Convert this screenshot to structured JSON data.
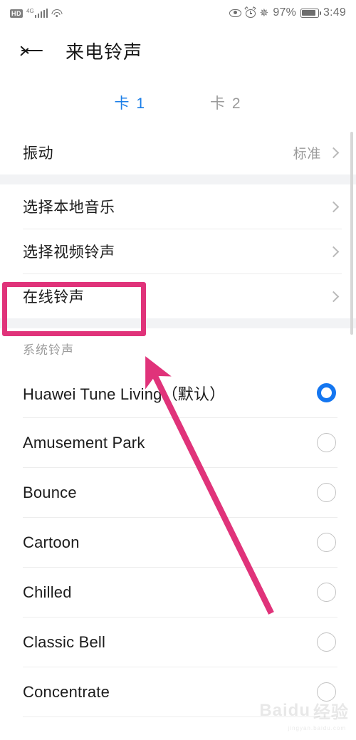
{
  "status_bar": {
    "hd_label": "HD",
    "network_type": "4G",
    "signal_icon": "signal-bars-icon",
    "wifi_icon": "wifi-icon",
    "eye_icon": "eye-comfort-icon",
    "alarm_icon": "alarm-clock-icon",
    "bluetooth_icon": "bluetooth-icon",
    "bluetooth_glyph": "✵",
    "battery_percent": "97%",
    "battery_icon": "battery-icon",
    "time": "3:49"
  },
  "header": {
    "back_icon": "back-arrow-icon",
    "title": "来电铃声"
  },
  "tabs": [
    {
      "label": "卡 1",
      "active": true
    },
    {
      "label": "卡 2",
      "active": false
    }
  ],
  "settings": {
    "vibration": {
      "label": "振动",
      "value": "标准"
    },
    "options": [
      {
        "label": "选择本地音乐"
      },
      {
        "label": "选择视频铃声"
      },
      {
        "label": "在线铃声"
      }
    ]
  },
  "system_section": {
    "title": "系统铃声",
    "ringtones": [
      {
        "name": "Huawei Tune Living（默认）",
        "selected": true
      },
      {
        "name": "Amusement Park",
        "selected": false
      },
      {
        "name": "Bounce",
        "selected": false
      },
      {
        "name": "Cartoon",
        "selected": false
      },
      {
        "name": "Chilled",
        "selected": false
      },
      {
        "name": "Classic Bell",
        "selected": false
      },
      {
        "name": "Concentrate",
        "selected": false
      }
    ]
  },
  "annotations": {
    "highlight_color": "#e0337a",
    "highlight_target": "在线铃声",
    "arrow_color": "#e0337a"
  },
  "watermark": {
    "text": "Baidu",
    "suffix": "经验",
    "subtext": "jingyan.baidu.com"
  },
  "colors": {
    "accent_blue": "#1476f0",
    "tab_blue": "#1a7ee8",
    "annotation_pink": "#e0337a",
    "section_gap": "#f2f3f5"
  }
}
